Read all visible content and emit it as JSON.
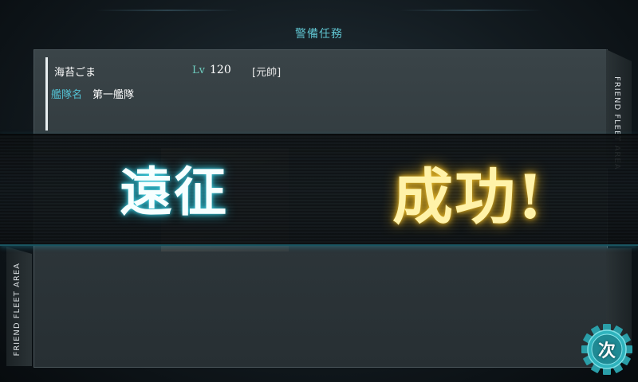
{
  "header": {
    "title": "警備任務"
  },
  "captain": {
    "name": "海苔ごま",
    "level_label": "Lv",
    "level": "120",
    "rank": "[元帥]"
  },
  "fleet": {
    "label": "艦隊名",
    "name": "第一艦隊"
  },
  "side_tabs": {
    "right": "FRIEND FLEET AREA",
    "left": "FRIEND FLEET AREA"
  },
  "result_banner": {
    "word1": "遠征",
    "word2": "成功!"
  },
  "next_button": {
    "label": "次",
    "icon": "gear-icon"
  },
  "colors": {
    "cyan_accent": "#5fc3cf",
    "gold_text": "#fff2a8",
    "panel": "#333c40"
  }
}
